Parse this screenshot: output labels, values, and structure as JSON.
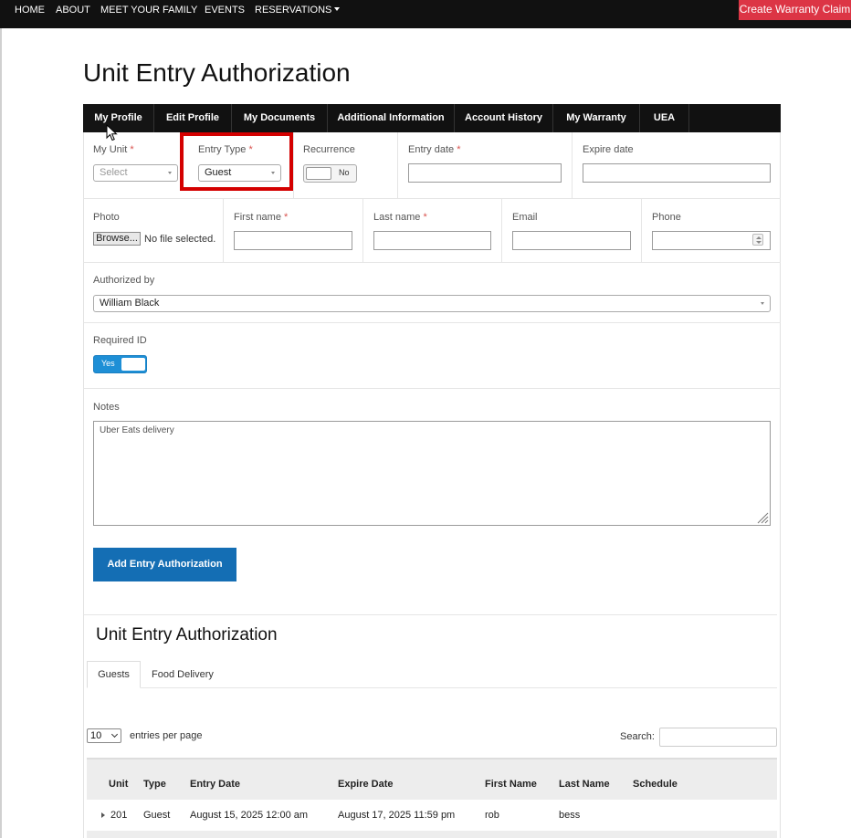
{
  "nav": {
    "items": [
      "HOME",
      "ABOUT",
      "MEET YOUR FAMILY",
      "EVENTS",
      "RESERVATIONS"
    ],
    "warranty_button": "Create Warranty Claim"
  },
  "page_title": "Unit Entry Authorization",
  "tabs": [
    "My Profile",
    "Edit Profile",
    "My Documents",
    "Additional Information",
    "Account History",
    "My Warranty",
    "UEA"
  ],
  "form": {
    "my_unit": {
      "label": "My Unit",
      "placeholder": "Select"
    },
    "entry_type": {
      "label": "Entry Type",
      "value": "Guest"
    },
    "recurrence": {
      "label": "Recurrence",
      "toggle_text": "No"
    },
    "entry_date": {
      "label": "Entry date",
      "value": ""
    },
    "expire_date": {
      "label": "Expire date",
      "value": ""
    },
    "photo": {
      "label": "Photo",
      "browse": "Browse...",
      "status": "No file selected."
    },
    "first_name": {
      "label": "First name",
      "value": ""
    },
    "last_name": {
      "label": "Last name",
      "value": ""
    },
    "email": {
      "label": "Email",
      "value": ""
    },
    "phone": {
      "label": "Phone",
      "value": ""
    },
    "authorized_by": {
      "label": "Authorized by",
      "value": "William Black"
    },
    "required_id": {
      "label": "Required ID",
      "toggle_text": "Yes"
    },
    "notes": {
      "label": "Notes",
      "value": "Uber Eats delivery"
    },
    "submit": "Add Entry Authorization",
    "required_marker": "*"
  },
  "listing": {
    "title": "Unit Entry Authorization",
    "subtabs": [
      "Guests",
      "Food Delivery"
    ],
    "page_length": "10",
    "entries_label": "entries per page",
    "search_label": "Search:",
    "columns": [
      "Unit",
      "Type",
      "Entry Date",
      "Expire Date",
      "First Name",
      "Last Name",
      "Schedule"
    ],
    "rows": [
      {
        "unit": "201",
        "type": "Guest",
        "entry_date": "August 15, 2025 12:00 am",
        "expire_date": "August 17, 2025 11:59 pm",
        "first_name": "rob",
        "last_name": "bess",
        "schedule": ""
      }
    ]
  },
  "colors": {
    "nav_bg": "#111111",
    "warranty": "#dc3545",
    "primary": "#146eb4",
    "toggle_on": "#1e8fd6",
    "highlight": "#d40000"
  }
}
